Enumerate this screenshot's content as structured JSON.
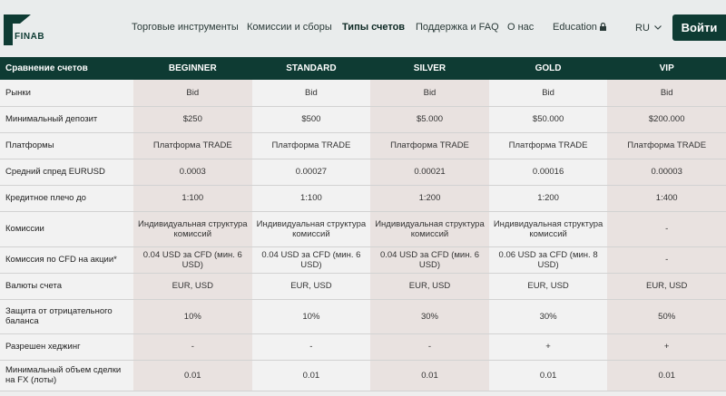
{
  "header": {
    "logo_text": "FINAB",
    "nav": [
      {
        "label": "Торговые инструменты"
      },
      {
        "label": "Комиссии и сборы"
      },
      {
        "label": "Типы счетов"
      },
      {
        "label": "Поддержка и FAQ"
      },
      {
        "label": "О нас"
      },
      {
        "label": "Education"
      }
    ],
    "language": "RU",
    "login_label": "Войти"
  },
  "table": {
    "header": [
      "Сравнение счетов",
      "BEGINNER",
      "STANDARD",
      "SILVER",
      "GOLD",
      "VIP"
    ],
    "rows": [
      [
        "Рынки",
        "Bid",
        "Bid",
        "Bid",
        "Bid",
        "Bid"
      ],
      [
        "Минимальный депозит",
        "$250",
        "$500",
        "$5.000",
        "$50.000",
        "$200.000"
      ],
      [
        "Платформы",
        "Платформа TRADE",
        "Платформа TRADE",
        "Платформа TRADE",
        "Платформа TRADE",
        "Платформа TRADE"
      ],
      [
        "Средний спред EURUSD",
        "0.0003",
        "0.00027",
        "0.00021",
        "0.00016",
        "0.00003"
      ],
      [
        "Кредитное плечо до",
        "1:100",
        "1:100",
        "1:200",
        "1:200",
        "1:400"
      ],
      [
        "Комиссии",
        "Индивидуальная структура комиссий",
        "Индивидуальная структура комиссий",
        "Индивидуальная структура комиссий",
        "Индивидуальная структура комиссий",
        "-"
      ],
      [
        "Комиссия по CFD на акции*",
        "0.04 USD за CFD (мин. 6 USD)",
        "0.04 USD за CFD (мин. 6 USD)",
        "0.04 USD за CFD (мин. 6 USD)",
        "0.06 USD за CFD (мин. 8 USD)",
        "-"
      ],
      [
        "Валюты счета",
        "EUR, USD",
        "EUR, USD",
        "EUR, USD",
        "EUR, USD",
        "EUR, USD"
      ],
      [
        "Защита от отрицательного баланса",
        "10%",
        "10%",
        "30%",
        "30%",
        "50%"
      ],
      [
        "Разрешен хеджинг",
        "-",
        "-",
        "-",
        "+",
        "+"
      ],
      [
        "Минимальный объем сделки на FX (лоты)",
        "0.01",
        "0.01",
        "0.01",
        "0.01",
        "0.01"
      ]
    ]
  }
}
